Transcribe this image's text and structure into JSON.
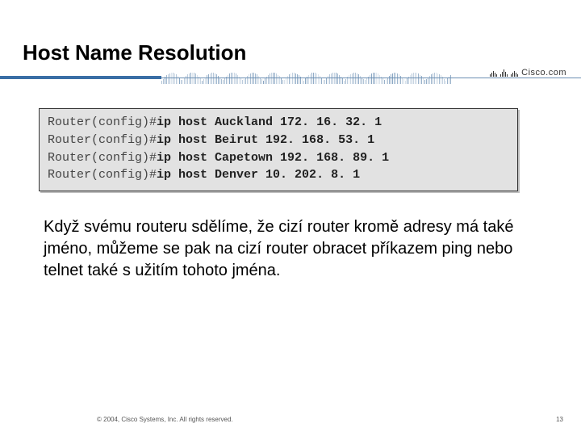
{
  "title": "Host Name Resolution",
  "logo_text": "Cisco.com",
  "code": {
    "prompt": "Router(config)#",
    "lines": [
      {
        "cmd": "ip host Auckland 172. 16. 32. 1"
      },
      {
        "cmd": "ip host Beirut 192. 168. 53. 1"
      },
      {
        "cmd": "ip host Capetown 192. 168. 89. 1"
      },
      {
        "cmd": "ip host Denver 10. 202. 8. 1"
      }
    ]
  },
  "body": "Když svému routeru sdělíme, že cizí router kromě adresy má také jméno, můžeme se pak na cizí router obracet příkazem ping nebo telnet také s užitím tohoto jména.",
  "footer": {
    "copyright": "© 2004, Cisco Systems, Inc. All rights reserved.",
    "page": "13"
  }
}
